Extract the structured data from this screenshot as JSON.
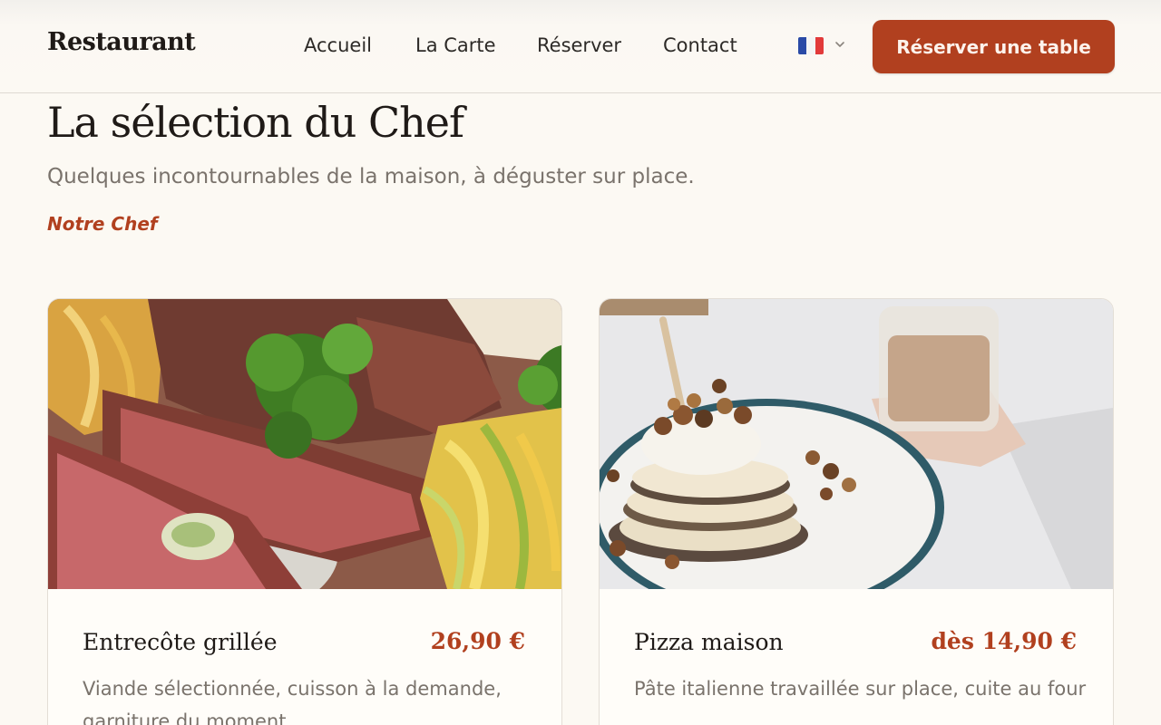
{
  "header": {
    "brand": "Restaurant",
    "nav": [
      {
        "label": "Accueil"
      },
      {
        "label": "La Carte"
      },
      {
        "label": "Réserver"
      },
      {
        "label": "Contact"
      }
    ],
    "language_flag": "french-flag-icon",
    "cta_label": "Réserver une table"
  },
  "section": {
    "title": "La sélection du Chef",
    "subtitle": "Quelques incontournables de la maison, à déguster sur place.",
    "tag": "Notre Chef"
  },
  "cards": [
    {
      "name": "Entrecôte grillée",
      "price": "26,90 €",
      "description": "Viande sélectionnée, cuisson à la demande, garniture du moment"
    },
    {
      "name": "Pizza maison",
      "price": "dès 14,90 €",
      "description": "Pâte italienne travaillée sur place, cuite au four"
    }
  ],
  "colors": {
    "accent": "#b1401f",
    "background": "#fcf9f3",
    "text": "#1f1a17",
    "muted": "#7a736c"
  }
}
